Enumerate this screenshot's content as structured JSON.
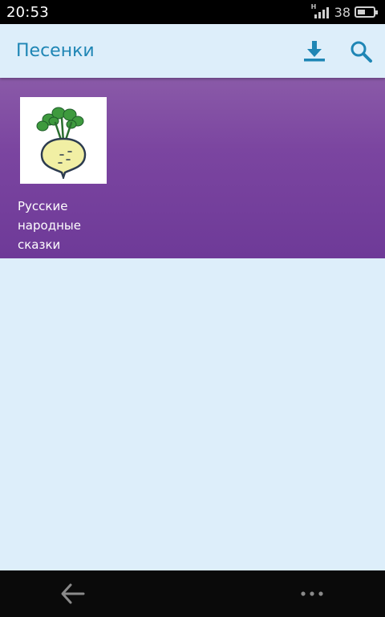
{
  "status_bar": {
    "time": "20:53",
    "network": "H",
    "battery_level": "38"
  },
  "app_bar": {
    "title": "Песенки",
    "actions": [
      {
        "icon": "download-icon"
      },
      {
        "icon": "search-icon"
      }
    ]
  },
  "content": {
    "items": [
      {
        "label": "Русские народные сказки",
        "thumbnail_icon": "turnip-icon"
      }
    ]
  },
  "navigation": {
    "back_icon": "arrow-left-icon",
    "more_icon": "more-dots-icon"
  },
  "colors": {
    "accent": "#1f86b5",
    "band": "#7b45a0",
    "background": "#ddeefa"
  }
}
